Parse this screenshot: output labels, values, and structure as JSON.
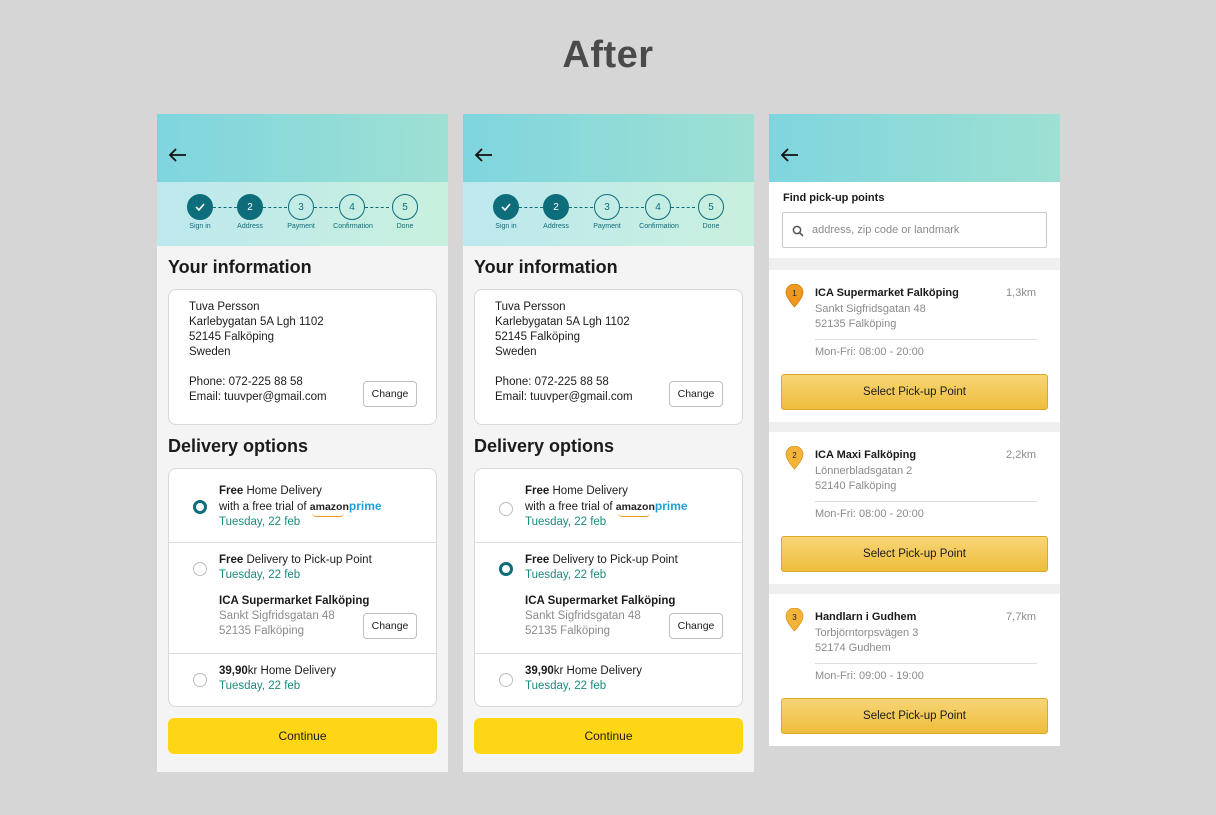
{
  "page_title": "After",
  "steps": [
    {
      "label": "Sign in",
      "num": "",
      "done": true
    },
    {
      "label": "Address",
      "num": "2",
      "done": true
    },
    {
      "label": "Payment",
      "num": "3",
      "done": false
    },
    {
      "label": "Confirmation",
      "num": "4",
      "done": false
    },
    {
      "label": "Done",
      "num": "5",
      "done": false
    }
  ],
  "info": {
    "title": "Your information",
    "name": "Tuva Persson",
    "street": "Karlebygatan 5A Lgh 1102",
    "city": "52145 Falköping",
    "country": "Sweden",
    "phone": "Phone: 072-225 88 58",
    "email": "Email: tuuvper@gmail.com",
    "change_label": "Change"
  },
  "delivery": {
    "title": "Delivery options",
    "home": {
      "free": "Free",
      "label": " Home Delivery",
      "trial": "with a free trial of",
      "amazon": "amazon",
      "prime": "prime",
      "date": "Tuesday, 22 feb"
    },
    "pickup": {
      "free": "Free",
      "label": " Delivery to Pick-up Point",
      "date": "Tuesday, 22 feb",
      "store": "ICA Supermarket Falköping",
      "street": "Sankt Sigfridsgatan 48",
      "city": "52135 Falköping",
      "change_label": "Change"
    },
    "paid": {
      "price": "39,90",
      "label": "kr Home Delivery",
      "date": "Tuesday, 22 feb"
    }
  },
  "panel1_selected": "home",
  "panel2_selected": "pickup",
  "continue_label": "Continue",
  "pickup_search": {
    "title": "Find pick-up points",
    "placeholder": "address, zip code or landmark"
  },
  "pickup_points": [
    {
      "num": "1",
      "name": "ICA Supermarket Falköping",
      "distance": "1,3km",
      "street": "Sankt Sigfridsgatan 48",
      "city": "52135 Falköping",
      "hours": "Mon-Fri: 08:00 - 20:00",
      "pin_color": "#f0971e",
      "button": "Select Pick-up Point"
    },
    {
      "num": "2",
      "name": "ICA Maxi Falköping",
      "distance": "2,2km",
      "street": "Lönnerbladsgatan 2",
      "city": "52140 Falköping",
      "hours": "Mon-Fri: 08:00 - 20:00",
      "pin_color": "#f4b43a",
      "button": "Select Pick-up Point"
    },
    {
      "num": "3",
      "name": "Handlarn i Gudhem",
      "distance": "7,7km",
      "street": "Torbjörntorpsvägen 3",
      "city": "52174 Gudhem",
      "hours": "Mon-Fri: 09:00 - 19:00",
      "pin_color": "#f4b43a",
      "button": "Select Pick-up Point"
    }
  ],
  "colors": {
    "accent": "#0e6d7a",
    "green_text": "#1a8a7c",
    "continue_yellow": "#ffd616",
    "select_gold": "#eebd3c"
  }
}
